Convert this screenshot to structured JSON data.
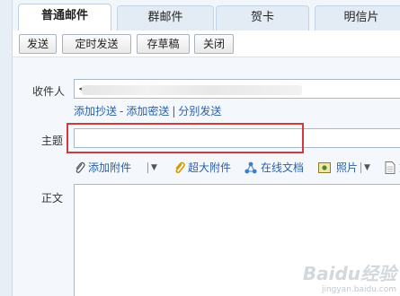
{
  "tabs": [
    {
      "label": "普通邮件",
      "active": true
    },
    {
      "label": "群邮件",
      "active": false
    },
    {
      "label": "贺卡",
      "active": false
    },
    {
      "label": "明信片",
      "active": false
    }
  ],
  "toolbar": {
    "send_label": "发送",
    "scheduled_send_label": "定时发送",
    "save_draft_label": "存草稿",
    "close_label": "关闭"
  },
  "compose": {
    "recipient_label": "收件人",
    "recipient_value": "<",
    "add_cc_label": "添加抄送",
    "add_bcc_label": "添加密送",
    "separate_send_label": "分别发送",
    "link_sep_dash": "-",
    "link_sep_pipe": "|",
    "subject_label": "主题",
    "subject_value": "",
    "body_label": "正文"
  },
  "attachments": {
    "add_attachment_label": "添加附件",
    "large_attachment_label": "超大附件",
    "online_docs_label": "在线文档",
    "photo_label": "照片",
    "doc_label": "文"
  },
  "watermark": {
    "main": "Baidu经验",
    "sub": "jingyan.baidu.com"
  },
  "colors": {
    "link": "#2a5fa8",
    "highlight": "#d23a3a",
    "background": "#f4f8fc"
  }
}
